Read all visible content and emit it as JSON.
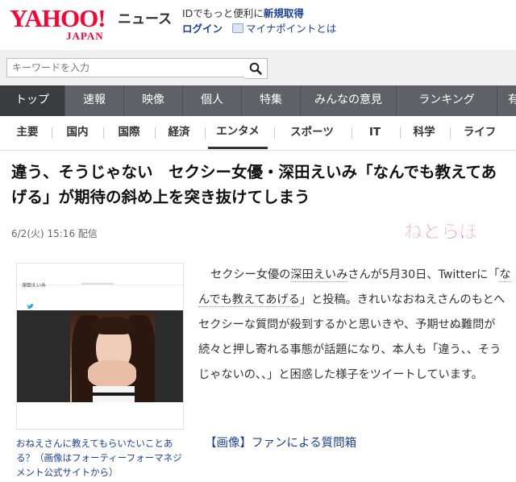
{
  "header": {
    "logo_main": "YAHOO!",
    "logo_sub": "JAPAN",
    "service": "ニュース",
    "promo_prefix": "IDでもっと便利に",
    "promo_link": "新規取得",
    "login": "ログイン",
    "mynumber": "マイナポイントとは"
  },
  "search": {
    "placeholder": "キーワードを入力",
    "icon": "search-icon"
  },
  "nav": {
    "items": [
      "トップ",
      "速報",
      "映像",
      "個人",
      "特集",
      "みんなの意見",
      "ランキング",
      "有"
    ]
  },
  "subnav": {
    "items": [
      "主要",
      "国内",
      "国際",
      "経済",
      "エンタメ",
      "スポーツ",
      "IT",
      "科学",
      "ライフ"
    ]
  },
  "article": {
    "title": "違う、そうじゃない　セクシー女優・深田えいみ「なんでも教えてあげる」が期待の斜め上を突き抜けてしまう",
    "date": "6/2(火) 15:16 配信",
    "source_logo": "ねとらぼ",
    "screenshot_name": "深田えいみ",
    "caption": "おねえさんに教えてもらいたいことある？（画像はフォーティーフォーマネジメント公式サイトから）",
    "body_1": "セクシー女優の",
    "body_link_1": "深田えいみ",
    "body_2": "さんが5月30日、Twitterに「",
    "body_link_2": "なんでも教えてあげる",
    "body_3": "」と投稿。きれいなおねえさんのもとへセクシーな質問が殺到するかと思いきや、予期せぬ難問が続々と押し寄れる事態が話題になり、本人も「違う、、そうじゃないの、、」と困惑した様子をツイートしています。",
    "related_link": "【画像】ファンによる質問箱"
  },
  "colors": {
    "brand_red": "#ff0033",
    "nav_bg": "#5e6266",
    "link_blue": "#1a3f9c"
  }
}
